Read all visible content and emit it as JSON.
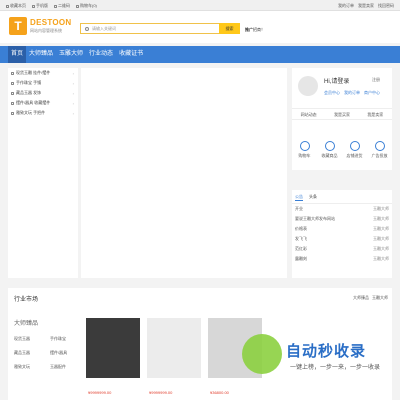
{
  "topbar": {
    "left": [
      "收藏本页",
      "手机版",
      "二维码",
      "购物车(0)"
    ],
    "right": [
      "我的订单",
      "我是卖家",
      "找回密码"
    ]
  },
  "logo": {
    "mark": "T",
    "name": "DESTOON",
    "sub": "网站内容管理系统"
  },
  "search": {
    "placeholder": "请输入关键词",
    "button": "搜索"
  },
  "ad": {
    "label": "推广",
    "text": "招商！"
  },
  "nav": [
    "首页",
    "大师臻品",
    "玉雕大师",
    "行业动态",
    "收藏证书"
  ],
  "sidebar": [
    "现货玉雕 挂件/摆件",
    "手作珠宝 手镯",
    "藏品玉器 发饰",
    "摆件/器具 收藏摆件",
    "雅致文玩 手把件"
  ],
  "user": {
    "hi": "Hi,请登录",
    "register": "注册",
    "links": [
      "会员中心",
      "我的订单",
      "商户中心"
    ],
    "tabs": [
      "网站动态",
      "我是买家",
      "我是卖家"
    ],
    "icons": [
      {
        "icon": "cart-icon",
        "label": "购物车"
      },
      {
        "icon": "heart-icon",
        "label": "收藏商品"
      },
      {
        "icon": "transfer-icon",
        "label": "店铺进货"
      },
      {
        "icon": "megaphone-icon",
        "label": "广告投放"
      }
    ]
  },
  "news": {
    "tabs": [
      "公告",
      "头条"
    ],
    "items": [
      {
        "title": "开业",
        "tag": "玉雕大师"
      },
      {
        "title": "要说王雕大师发布网站",
        "tag": "玉雕大师"
      },
      {
        "title": "价格表",
        "tag": "玉雕大师"
      },
      {
        "title": "发飞飞",
        "tag": "玉雕大师"
      },
      {
        "title": "范红彩",
        "tag": "玉雕大师"
      },
      {
        "title": "露雕刻",
        "tag": "玉雕大师"
      }
    ]
  },
  "market": {
    "title": "行业市场",
    "links": [
      "大师臻品",
      "玉雕大师"
    ],
    "category": "大师臻品",
    "items": [
      "现货玉器",
      "手作珠宝",
      "藏品玉器",
      "摆件/器具",
      "雅致文玩",
      "玉器配件"
    ],
    "prices": [
      "¥9999999.00",
      "¥9999999.00",
      "¥36800.00"
    ]
  },
  "watermark": {
    "text": "自动秒收录",
    "sub": "一键上榜，一步一来，一步一收录"
  }
}
